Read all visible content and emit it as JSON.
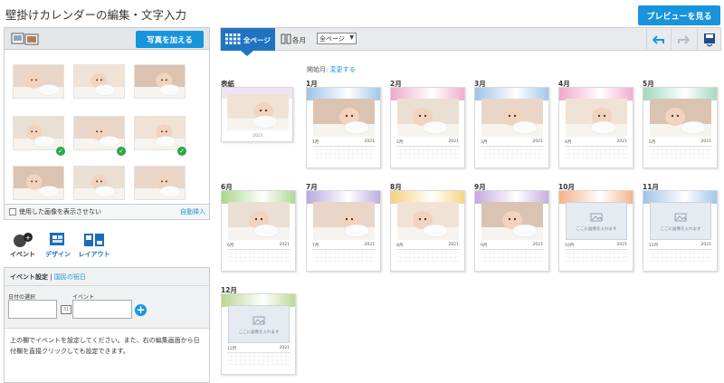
{
  "header": {
    "title": "壁掛けカレンダーの編集・文字入力",
    "preview_label": "プレビューを見る"
  },
  "photos": {
    "add_label": "写真を加える",
    "hide_used_label": "使用した画像を表示させない",
    "auto_insert_label": "自動挿入",
    "thumbs": [
      {
        "used": false
      },
      {
        "used": false
      },
      {
        "used": false
      },
      {
        "used": true
      },
      {
        "used": true
      },
      {
        "used": true
      },
      {
        "used": false
      },
      {
        "used": false
      },
      {
        "used": false
      }
    ]
  },
  "tools": {
    "tabs": [
      {
        "label": "イベント",
        "icon": "event-icon",
        "active": true
      },
      {
        "label": "デザイン",
        "icon": "design-icon",
        "active": false
      },
      {
        "label": "レイアウト",
        "icon": "layout-icon",
        "active": false
      }
    ]
  },
  "event": {
    "tab_active": "イベント設定",
    "separator": "|",
    "tab_holiday": "国民の祝日",
    "date_label": "日付の選択",
    "event_label": "イベント",
    "help_text": "上の欄でイベントを設定してください。また、右の編集画面から日付欄を直接クリックしても設定できます。"
  },
  "toolbar": {
    "all_pages_label": "全ページ",
    "each_month_label": "各月",
    "page_select_value": "全ページ",
    "colors": {
      "accent": "#1794dc",
      "tab_active": "#1f74c2"
    }
  },
  "calendar": {
    "start_month_label": "開始月:",
    "change_label": "変更する",
    "cover": {
      "label": "表紙",
      "caption": "2021"
    },
    "months": [
      {
        "label": "1月",
        "cal_label": "1月",
        "year": "2021",
        "has_photo": true,
        "tint": "#9fc3e8"
      },
      {
        "label": "2月",
        "cal_label": "2月",
        "year": "2021",
        "has_photo": true,
        "tint": "#f0a9c9"
      },
      {
        "label": "3月",
        "cal_label": "3月",
        "year": "2021",
        "has_photo": true,
        "tint": "#9fc3e8"
      },
      {
        "label": "4月",
        "cal_label": "4月",
        "year": "2021",
        "has_photo": true,
        "tint": "#f0a9c9"
      },
      {
        "label": "5月",
        "cal_label": "5月",
        "year": "2021",
        "has_photo": true,
        "tint": "#9fd8c0"
      },
      {
        "label": "6月",
        "cal_label": "6月",
        "year": "2021",
        "has_photo": true,
        "tint": "#a8d88f"
      },
      {
        "label": "7月",
        "cal_label": "7月",
        "year": "2021",
        "has_photo": true,
        "tint": "#b9a9e0"
      },
      {
        "label": "8月",
        "cal_label": "8月",
        "year": "2021",
        "has_photo": true,
        "tint": "#f3d27a"
      },
      {
        "label": "9月",
        "cal_label": "9月",
        "year": "2021",
        "has_photo": true,
        "tint": "#c4a9e0"
      },
      {
        "label": "10月",
        "cal_label": "10月",
        "year": "2021",
        "has_photo": false,
        "tint": "#f4b183",
        "placeholder": "ここに画像を入れます"
      },
      {
        "label": "11月",
        "cal_label": "11月",
        "year": "2021",
        "has_photo": false,
        "tint": "#9fc3e8",
        "placeholder": "ここに画像を入れます"
      },
      {
        "label": "12月",
        "cal_label": "12月",
        "year": "2021",
        "has_photo": false,
        "tint": "#b9d88f",
        "placeholder": "ここに画像を入れます"
      }
    ]
  }
}
